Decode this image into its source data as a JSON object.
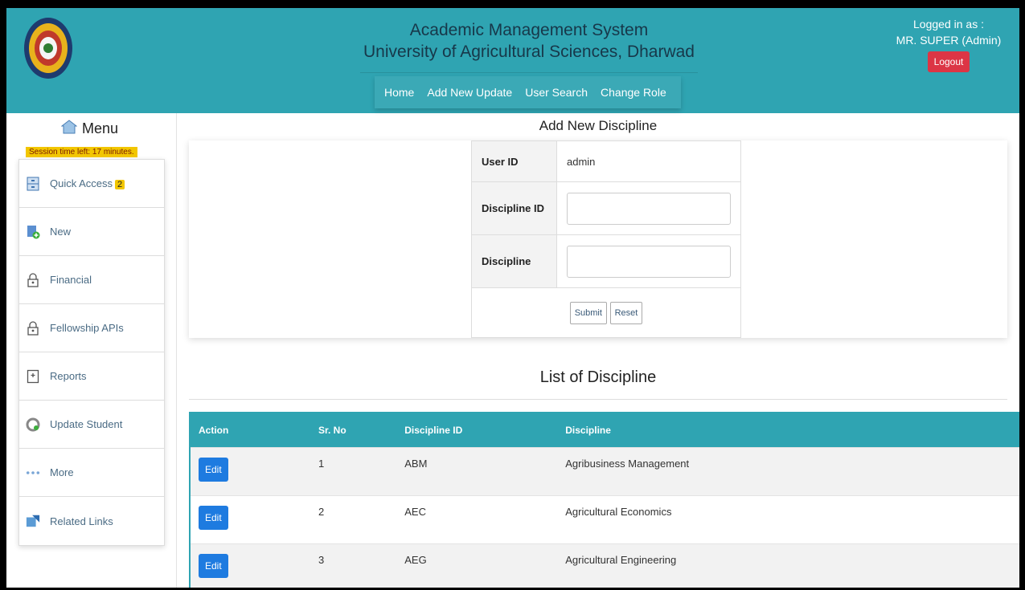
{
  "header": {
    "title_line1": "Academic Management System",
    "title_line2": "University of Agricultural Sciences, Dharwad",
    "logo_icon": "university-seal-logo",
    "nav": [
      "Home",
      "Add New Update",
      "User Search",
      "Change Role"
    ],
    "logged_label": "Logged in as :",
    "user_name": "MR. SUPER (Admin)",
    "logout_label": "Logout"
  },
  "sidebar": {
    "menu_title": "Menu",
    "session_note": "Session time left: 17 minutes.",
    "items": [
      {
        "label": "Quick Access",
        "badge": "2",
        "icon": "drawer-icon"
      },
      {
        "label": "New",
        "icon": "new-file-icon"
      },
      {
        "label": "Financial",
        "icon": "lock-icon"
      },
      {
        "label": "Fellowship APIs",
        "icon": "lock-icon"
      },
      {
        "label": "Reports",
        "icon": "report-icon"
      },
      {
        "label": "Update Student",
        "icon": "refresh-icon"
      },
      {
        "label": "More",
        "icon": "more-dots-icon"
      },
      {
        "label": "Related Links",
        "icon": "external-link-icon"
      }
    ]
  },
  "form": {
    "heading": "Add New Discipline",
    "user_id_label": "User ID",
    "user_id_value": "admin",
    "discipline_id_label": "Discipline ID",
    "discipline_id_value": "",
    "discipline_label": "Discipline",
    "discipline_value": "",
    "submit_label": "Submit",
    "reset_label": "Reset"
  },
  "list": {
    "heading": "List of Discipline",
    "columns": [
      "Action",
      "Sr. No",
      "Discipline ID",
      "Discipline"
    ],
    "rows": [
      {
        "action": "Edit",
        "sr": "1",
        "id": "ABM",
        "name": "Agribusiness Management"
      },
      {
        "action": "Edit",
        "sr": "2",
        "id": "AEC",
        "name": "Agricultural Economics"
      },
      {
        "action": "Edit",
        "sr": "3",
        "id": "AEG",
        "name": "Agricultural Engineering"
      }
    ]
  },
  "colors": {
    "header_teal": "#2fa4b2",
    "logout_red": "#dc3545",
    "edit_blue": "#1e7be0",
    "badge_yellow": "#f2c600"
  }
}
